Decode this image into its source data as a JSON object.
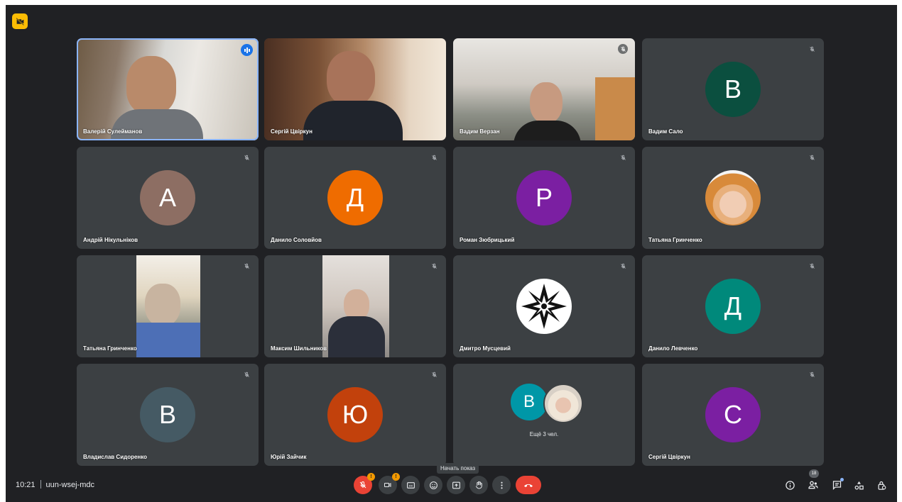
{
  "meeting": {
    "time": "10:21",
    "code": "uun-wsej-mdc"
  },
  "tiles": [
    {
      "name": "Валерій Сулейманов",
      "type": "video",
      "speaking": true
    },
    {
      "name": "Сергій Цвіркун",
      "type": "video"
    },
    {
      "name": "Вадим Верзан",
      "type": "video"
    },
    {
      "name": "Вадим Сало",
      "type": "avatar",
      "initial": "В",
      "color": "#0b4f3f"
    },
    {
      "name": "Андрій Нікульніков",
      "type": "avatar",
      "initial": "А",
      "color": "#8d6e63"
    },
    {
      "name": "Данило Соловйов",
      "type": "avatar",
      "initial": "Д",
      "color": "#ef6c00"
    },
    {
      "name": "Роман Зюбрицький",
      "type": "avatar",
      "initial": "Р",
      "color": "#7b1fa2"
    },
    {
      "name": "Татьяна Гринченко",
      "type": "photo"
    },
    {
      "name": "Татьяна Гринченко",
      "type": "video"
    },
    {
      "name": "Максим Шильников",
      "type": "video"
    },
    {
      "name": "Дмитро Мусцевий",
      "type": "logo"
    },
    {
      "name": "Данило Левченко",
      "type": "avatar",
      "initial": "Д",
      "color": "#00897b"
    },
    {
      "name": "Владислав Сидоренко",
      "type": "avatar",
      "initial": "В",
      "color": "#455a64"
    },
    {
      "name": "Юрій Зайчик",
      "type": "avatar",
      "initial": "Ю",
      "color": "#c2410c"
    },
    {
      "name": "",
      "type": "more",
      "more_initial": "В",
      "more_color": "#0097a7",
      "more_label": "Ещё 3 чел."
    },
    {
      "name": "Сергій Цвіркун",
      "type": "avatar",
      "initial": "С",
      "color": "#7b1fa2"
    }
  ],
  "controls": {
    "tooltip": "Начать показ",
    "mic_badge": "!",
    "camera_badge": "!",
    "participants_count": "18"
  },
  "icons": {
    "top_badge": "camera-off-icon",
    "mute": "mic-off-icon",
    "speaking": "audio-level-icon",
    "captions": "captions-icon",
    "emoji": "emoji-icon",
    "present": "present-screen-icon",
    "hand": "raise-hand-icon",
    "more": "more-vert-icon",
    "hangup": "call-end-icon",
    "info": "info-icon",
    "people": "people-icon",
    "chat": "chat-icon",
    "activities": "activities-icon",
    "host": "host-controls-icon"
  }
}
